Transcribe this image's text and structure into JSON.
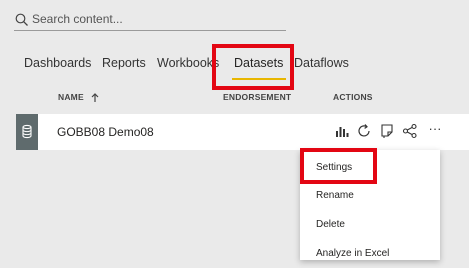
{
  "search": {
    "placeholder": "Search content..."
  },
  "tabs": [
    {
      "label": "Dashboards"
    },
    {
      "label": "Reports"
    },
    {
      "label": "Workbooks"
    },
    {
      "label": "Datasets",
      "active": true
    },
    {
      "label": "Dataflows"
    }
  ],
  "columns": {
    "name": "NAME",
    "endorsement": "ENDORSEMENT",
    "actions": "ACTIONS"
  },
  "row": {
    "name": "GOBB08 Demo08",
    "icon": "dataset-icon"
  },
  "actions": [
    "analyze-icon",
    "refresh-icon",
    "create-report-icon",
    "share-icon",
    "more-options-icon"
  ],
  "more_label": "···",
  "menu": {
    "items": [
      {
        "label": "Settings"
      },
      {
        "label": "Rename"
      },
      {
        "label": "Delete"
      },
      {
        "label": "Analyze in Excel"
      }
    ]
  },
  "colors": {
    "accent": "#e8b600",
    "highlight": "#e30613",
    "dataset_tile": "#5f6b6d"
  }
}
